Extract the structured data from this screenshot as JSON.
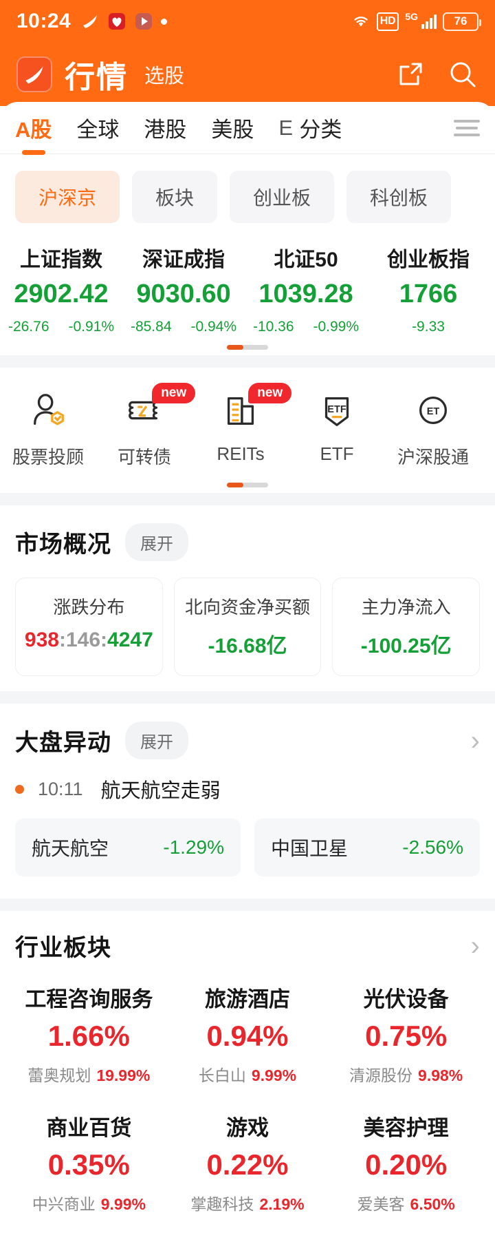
{
  "status_bar": {
    "time": "10:24",
    "left_icons": [
      "app-logo-icon",
      "festival-icon",
      "player-icon",
      "dot-icon"
    ],
    "wifi": "wifi-icon",
    "hd": "HD",
    "network": "5G",
    "signal": "signal-icon",
    "battery": "76"
  },
  "app_bar": {
    "logo": "app-logo-icon",
    "title": "行情",
    "subtitle": "选股",
    "share_icon": "share-icon",
    "search_icon": "search-icon"
  },
  "tabs": [
    {
      "label": "A股",
      "active": true
    },
    {
      "label": "全球",
      "active": false
    },
    {
      "label": "港股",
      "active": false
    },
    {
      "label": "美股",
      "active": false
    },
    {
      "label": "E",
      "active": false,
      "clipped": true
    },
    {
      "label": "分类",
      "active": false
    }
  ],
  "tab_menu_icon": "hamburger-menu-icon",
  "chips": [
    {
      "label": "沪深京",
      "active": true
    },
    {
      "label": "板块",
      "active": false
    },
    {
      "label": "创业板",
      "active": false
    },
    {
      "label": "科创板",
      "active": false
    }
  ],
  "indices": [
    {
      "name": "上证指数",
      "value": "2902.42",
      "change": "-26.76",
      "pct": "-0.91%",
      "dir": "down"
    },
    {
      "name": "深证成指",
      "value": "9030.60",
      "change": "-85.84",
      "pct": "-0.94%",
      "dir": "down"
    },
    {
      "name": "北证50",
      "value": "1039.28",
      "change": "-10.36",
      "pct": "-0.99%",
      "dir": "down"
    },
    {
      "name": "创业板指",
      "value": "1766",
      "change": "-9.33",
      "pct": "",
      "dir": "down"
    }
  ],
  "quick_actions": [
    {
      "label": "股票投顾",
      "icon": "advisor-person-icon",
      "badge": ""
    },
    {
      "label": "可转债",
      "icon": "convertible-bond-icon",
      "badge": "new"
    },
    {
      "label": "REITs",
      "icon": "reits-building-icon",
      "badge": "new"
    },
    {
      "label": "ETF",
      "icon": "etf-icon",
      "badge": ""
    },
    {
      "label": "沪深股通",
      "icon": "etf-icon",
      "badge": ""
    }
  ],
  "market_overview": {
    "title": "市场概况",
    "expand_label": "展开",
    "cards": [
      {
        "label": "涨跌分布",
        "up": "938",
        "sep1": ":",
        "flat": "146",
        "sep2": ":",
        "down": "4247",
        "type": "distribution"
      },
      {
        "label": "北向资金净买额",
        "value": "-16.68亿",
        "dir": "down",
        "type": "value"
      },
      {
        "label": "主力净流入",
        "value": "-100.25亿",
        "dir": "down",
        "type": "value"
      }
    ]
  },
  "market_movers": {
    "title": "大盘异动",
    "expand_label": "展开",
    "arrow_icon": "chevron-right-icon",
    "event": {
      "time": "10:11",
      "text": "航天航空走弱"
    },
    "stocks": [
      {
        "name": "航天航空",
        "pct": "-1.29%",
        "dir": "down"
      },
      {
        "name": "中国卫星",
        "pct": "-2.56%",
        "dir": "down"
      }
    ]
  },
  "industry_sectors": {
    "title": "行业板块",
    "arrow_icon": "chevron-right-icon",
    "items": [
      {
        "name": "工程咨询服务",
        "pct": "1.66%",
        "lead_name": "蕾奥规划",
        "lead_pct": "19.99%"
      },
      {
        "name": "旅游酒店",
        "pct": "0.94%",
        "lead_name": "长白山",
        "lead_pct": "9.99%"
      },
      {
        "name": "光伏设备",
        "pct": "0.75%",
        "lead_name": "清源股份",
        "lead_pct": "9.98%"
      },
      {
        "name": "商业百货",
        "pct": "0.35%",
        "lead_name": "中兴商业",
        "lead_pct": "9.99%"
      },
      {
        "name": "游戏",
        "pct": "0.22%",
        "lead_name": "掌趣科技",
        "lead_pct": "2.19%"
      },
      {
        "name": "美容护理",
        "pct": "0.20%",
        "lead_name": "爱美客",
        "lead_pct": "6.50%"
      }
    ]
  },
  "colors": {
    "brand_orange": "#ff6a13",
    "up_red": "#e8262b",
    "down_green": "#14a037",
    "neutral_grey": "#9a9a9a"
  }
}
